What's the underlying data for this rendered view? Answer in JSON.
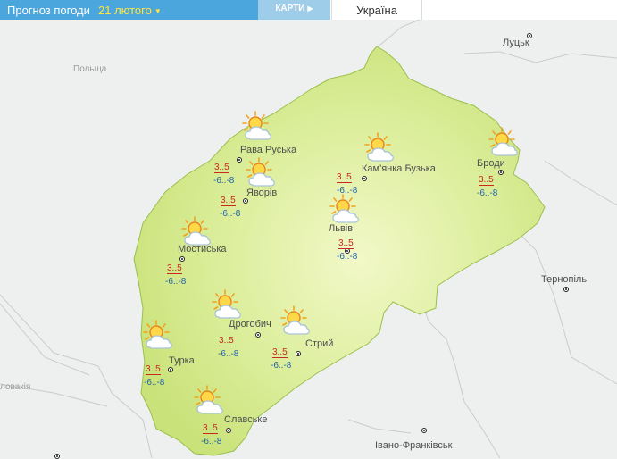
{
  "header": {
    "title": "Прогноз погоди",
    "date": "21 лютого",
    "maps_tab": "КАРТИ",
    "country_tab": "Україна"
  },
  "neighbors": [
    {
      "name": "Польща"
    },
    {
      "name": "Луцьк"
    },
    {
      "name": "Тернопіль"
    },
    {
      "name": "Івано-Франківськ"
    },
    {
      "name": "ловакія"
    }
  ],
  "icon": "sun-behind-cloud-icon",
  "cities": [
    {
      "name": "Рава Руська",
      "day": "3..5",
      "night": "-6..-8"
    },
    {
      "name": "Яворів",
      "day": "3..5",
      "night": "-6..-8"
    },
    {
      "name": "Кам'янка Бузька",
      "day": "3..5",
      "night": "-6..-8"
    },
    {
      "name": "Броди",
      "day": "3..5",
      "night": "-6..-8"
    },
    {
      "name": "Мостиська",
      "day": "3..5",
      "night": "-6..-8"
    },
    {
      "name": "Львів",
      "day": "3..5",
      "night": "-6..-8"
    },
    {
      "name": "Дрогобич",
      "day": "3..5",
      "night": "-6..-8"
    },
    {
      "name": "Стрий",
      "day": "3..5",
      "night": "-6..-8"
    },
    {
      "name": "Турка",
      "day": "3..5",
      "night": "-6..-8"
    },
    {
      "name": "Славське",
      "day": "3..5",
      "night": "-6..-8"
    }
  ]
}
